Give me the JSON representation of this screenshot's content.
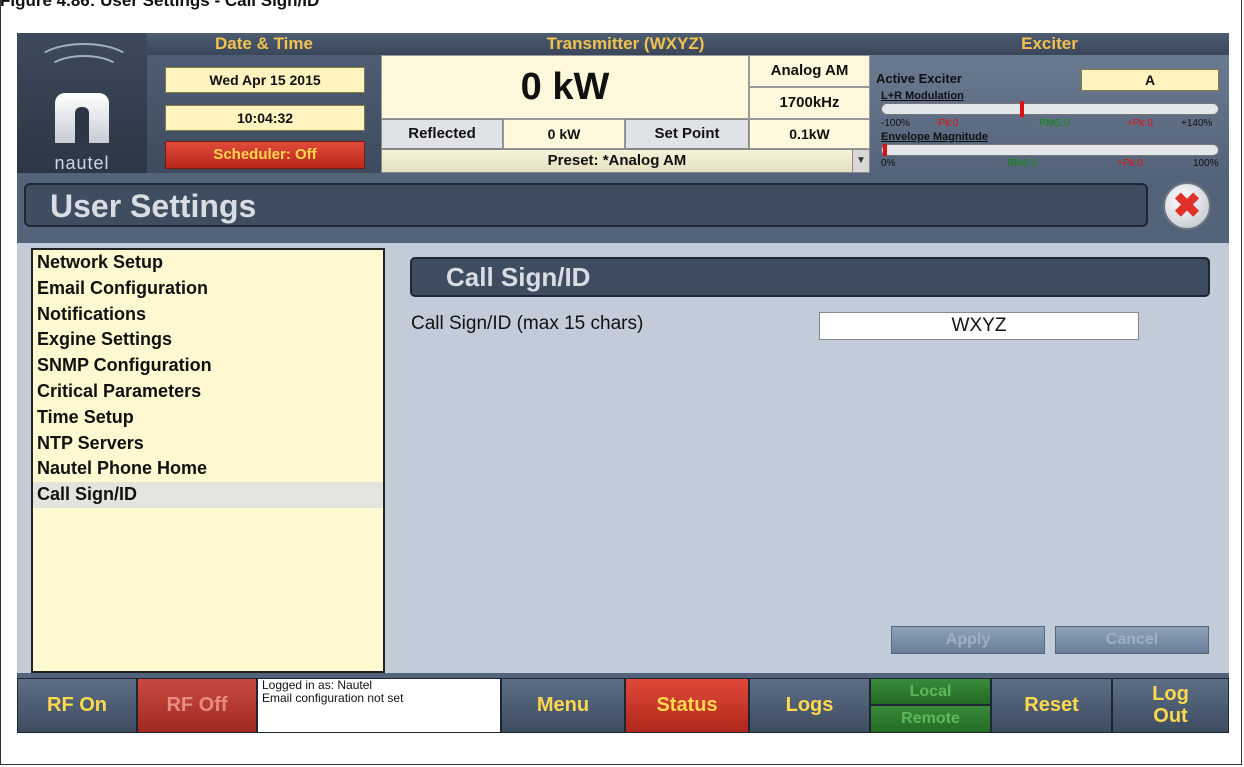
{
  "doc_heading": "Figure 4.86: User Settings - Call Sign/ID",
  "header": {
    "logo_text": "nautel",
    "datetime_title": "Date & Time",
    "date": "Wed Apr 15 2015",
    "time": "10:04:32",
    "scheduler": "Scheduler: Off",
    "transmitter_title": "Transmitter (WXYZ)",
    "power": "0 kW",
    "mode": "Analog AM",
    "frequency": "1700kHz",
    "reflected_label": "Reflected",
    "reflected_value": "0 kW",
    "setpoint_label": "Set Point",
    "setpoint_value": "0.1kW",
    "preset": "Preset: *Analog AM",
    "exciter_title": "Exciter",
    "active_exciter_label": "Active Exciter",
    "active_exciter_value": "A",
    "lr_mod_label": "L+R Modulation",
    "lr_scale": {
      "min": "-100%",
      "neg_pk": "-Pk:0",
      "rms": "RMS:0",
      "pos_pk": "+Pk:0",
      "max": "+140%"
    },
    "env_label": "Envelope Magnitude",
    "env_scale": {
      "min": "0%",
      "rms": "RMS:0",
      "pos_pk": "+Pk:0",
      "max": "100%"
    }
  },
  "page": {
    "title": "User Settings"
  },
  "sidebar": {
    "items": [
      {
        "label": "Network Setup"
      },
      {
        "label": "Email Configuration"
      },
      {
        "label": "Notifications"
      },
      {
        "label": "Exgine Settings"
      },
      {
        "label": "SNMP Configuration"
      },
      {
        "label": "Critical Parameters"
      },
      {
        "label": "Time Setup"
      },
      {
        "label": "NTP Servers"
      },
      {
        "label": "Nautel Phone Home"
      },
      {
        "label": "Call Sign/ID"
      }
    ],
    "selected": "Call Sign/ID"
  },
  "main": {
    "section_title": "Call Sign/ID",
    "field_label": "Call Sign/ID (max 15 chars)",
    "field_value": "WXYZ",
    "apply_label": "Apply",
    "cancel_label": "Cancel"
  },
  "footer": {
    "rf_on": "RF On",
    "rf_off": "RF Off",
    "status_line1": "Logged in as: Nautel",
    "status_line2": "Email configuration not set",
    "menu": "Menu",
    "status": "Status",
    "logs": "Logs",
    "local": "Local",
    "remote": "Remote",
    "reset": "Reset",
    "logout_line1": "Log",
    "logout_line2": "Out"
  }
}
